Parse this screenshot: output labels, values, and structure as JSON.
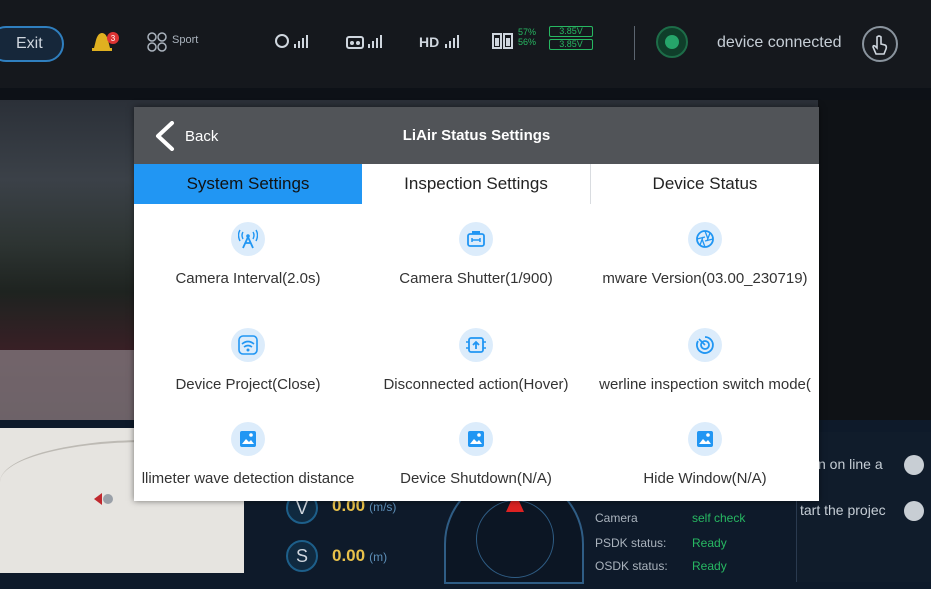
{
  "topbar": {
    "exit_label": "Exit",
    "bell_badge": "3",
    "flight_mode": "Sport",
    "hd_label": "HD",
    "battery_pct_1": "57%",
    "battery_pct_2": "56%",
    "battery_v_1": "3.85V",
    "battery_v_2": "3.85V",
    "connection_status": "device connected",
    "status_color": "#27b862"
  },
  "dashboard": {
    "gauges": [
      {
        "letter": "V",
        "value": "0.00",
        "unit": "(m/s)"
      },
      {
        "letter": "S",
        "value": "0.00",
        "unit": "(m)"
      }
    ],
    "status_rows": [
      {
        "label": "Camera",
        "value": "self check"
      },
      {
        "label": "PSDK status:",
        "value": "Ready"
      },
      {
        "label": "OSDK status:",
        "value": "Ready"
      }
    ],
    "side_rows": [
      {
        "label": "n on line a"
      },
      {
        "label": "tart the projec"
      }
    ]
  },
  "modal": {
    "back_label": "Back",
    "title": "LiAir Status Settings",
    "accent_color": "#2196f3",
    "tabs": [
      {
        "label": "System Settings",
        "active": true
      },
      {
        "label": "Inspection Settings",
        "active": false
      },
      {
        "label": "Device Status",
        "active": false
      }
    ],
    "items": [
      {
        "label": "Camera Interval(2.0s)",
        "icon": "antenna-icon"
      },
      {
        "label": "Camera Shutter(1/900)",
        "icon": "camera-shutter-icon"
      },
      {
        "label": "mware Version(03.00_230719)",
        "icon": "aperture-icon"
      },
      {
        "label": "Device Project(Close)",
        "icon": "wifi-project-icon"
      },
      {
        "label": "Disconnected action(Hover)",
        "icon": "upload-chip-icon"
      },
      {
        "label": "werline inspection switch mode(",
        "icon": "target-swirl-icon"
      },
      {
        "label": "llimeter wave detection distance",
        "icon": "image-icon"
      },
      {
        "label": "Device Shutdown(N/A)",
        "icon": "image-icon"
      },
      {
        "label": "Hide Window(N/A)",
        "icon": "image-icon"
      }
    ]
  }
}
